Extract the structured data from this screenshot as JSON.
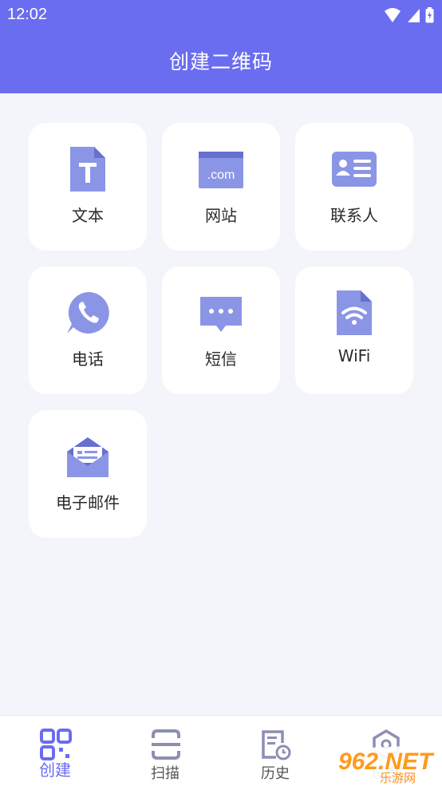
{
  "status": {
    "time": "12:02"
  },
  "header": {
    "title": "创建二维码"
  },
  "cards": [
    {
      "label": "文本"
    },
    {
      "label": "网站"
    },
    {
      "label": "联系人"
    },
    {
      "label": "电话"
    },
    {
      "label": "短信"
    },
    {
      "label": "WiFi"
    },
    {
      "label": "电子邮件"
    }
  ],
  "website_icon_text": ".com",
  "nav": [
    {
      "label": "创建",
      "active": true
    },
    {
      "label": "扫描"
    },
    {
      "label": "历史"
    },
    {
      "label": "设置"
    }
  ],
  "watermark": {
    "text": "962.NET",
    "sub": "乐游网"
  },
  "colors": {
    "accent": "#6a6df0",
    "icon": "#7b85e8",
    "background": "#f4f5fb"
  }
}
